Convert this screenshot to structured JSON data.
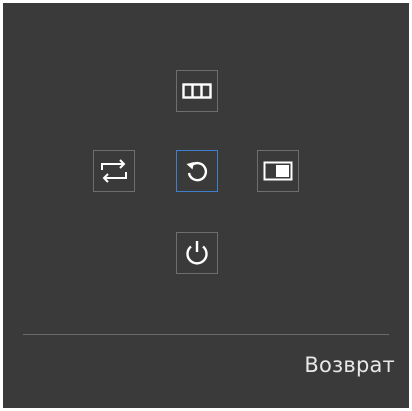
{
  "osd": {
    "caption": "Возврат",
    "selected": "center",
    "accent_color": "#3f7fc9",
    "icons": {
      "up": "menu-grid-icon",
      "left": "source-swap-icon",
      "center": "return-icon",
      "right": "picture-mode-icon",
      "down": "power-icon"
    }
  }
}
